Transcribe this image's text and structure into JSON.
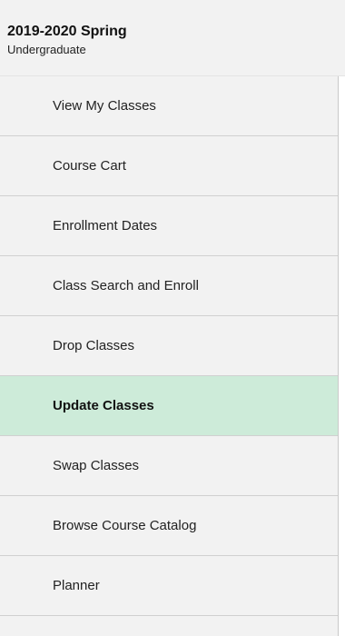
{
  "header": {
    "term": "2019-2020 Spring",
    "career": "Undergraduate"
  },
  "nav": {
    "items": [
      {
        "label": "View My Classes"
      },
      {
        "label": "Course Cart"
      },
      {
        "label": "Enrollment Dates"
      },
      {
        "label": "Class Search and Enroll"
      },
      {
        "label": "Drop Classes"
      },
      {
        "label": "Update Classes",
        "active": true
      },
      {
        "label": "Swap Classes"
      },
      {
        "label": "Browse Course Catalog"
      },
      {
        "label": "Planner"
      }
    ]
  },
  "colors": {
    "active_bg": "#cdebd9",
    "item_bg": "#f2f2f2",
    "divider": "#d0d0d0"
  }
}
